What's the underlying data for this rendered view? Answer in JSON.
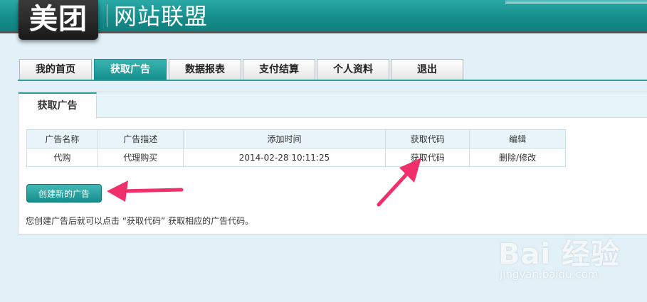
{
  "header": {
    "logo_text": "美团",
    "site_title": "网站联盟"
  },
  "nav": {
    "tabs": [
      {
        "label": "我的首页"
      },
      {
        "label": "获取广告"
      },
      {
        "label": "数据报表"
      },
      {
        "label": "支付结算"
      },
      {
        "label": "个人资料"
      },
      {
        "label": "退出"
      }
    ],
    "active_index": 1
  },
  "panel": {
    "tab_label": "获取广告",
    "table": {
      "headers": [
        "广告名称",
        "广告描述",
        "添加时间",
        "获取代码",
        "编辑"
      ],
      "rows": [
        {
          "name": "代购",
          "description": "代理购买",
          "added_time": "2014-02-28 10:11:25",
          "get_code": "获取代码",
          "edit": "删除/修改"
        }
      ]
    },
    "create_button": "创建新的广告",
    "hint": "您创建广告后就可以点击 “获取代码” 获取相应的广告代码。"
  },
  "watermark": {
    "main": "Bai 经验",
    "sub": "jingyan.baidu.com"
  },
  "colors": {
    "brand_teal": "#148c8a",
    "arrow": "#f0306a",
    "page_bg": "#e2f1f7"
  }
}
